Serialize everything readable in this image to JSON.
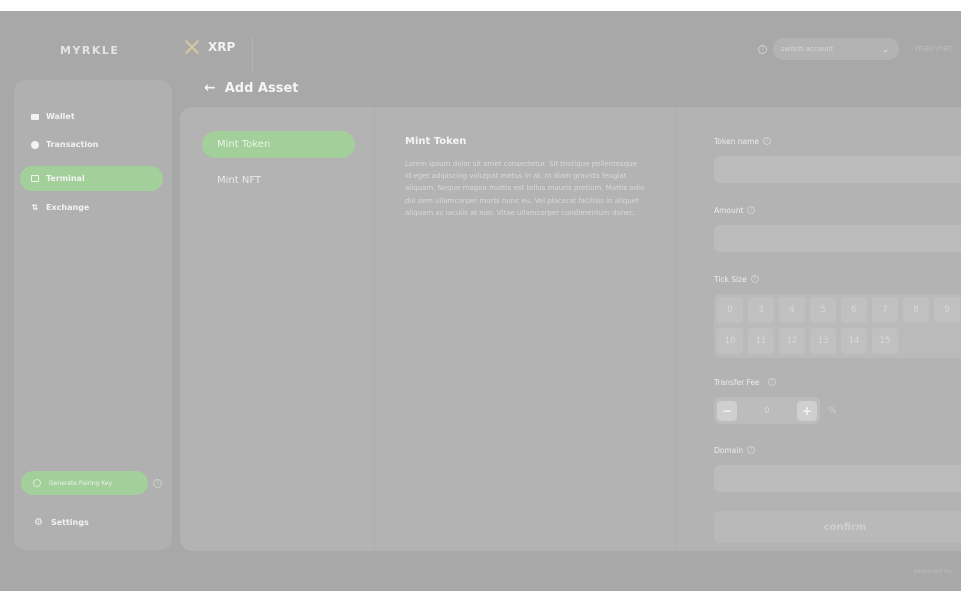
{
  "header": {
    "logo": "MYRKLE",
    "chain_label": "XRP",
    "switch_account_placeholder": "switch account",
    "network": "mainnet"
  },
  "sidebar": {
    "items": [
      {
        "label": "Wallet",
        "icon": "wallet-icon"
      },
      {
        "label": "Transaction",
        "icon": "transaction-icon"
      },
      {
        "label": "Terminal",
        "icon": "terminal-icon",
        "active": true
      },
      {
        "label": "Exchange",
        "icon": "exchange-icon"
      }
    ],
    "generate_key_label": "Generate Pairing Key",
    "settings_label": "Settings"
  },
  "page": {
    "title": "Add Asset"
  },
  "tabs": [
    {
      "label": "Mint Token",
      "active": true
    },
    {
      "label": "Mint NFT",
      "active": false
    }
  ],
  "description": {
    "title": "Mint Token",
    "body": "Lorem ipsum dolor sit amet consectetur. Sit tristique pellentesque id eget adipiscing volutpat metus in at. In diam gravida feugiat aliquam. Neque magna mattis est tellus mauris pretium. Mattis odio dui sem ullamcorper morbi nunc eu. Vel placerat facilisis in aliquet aliquam ac iaculis at non. Vitae ullamcorper condimentum donec."
  },
  "form": {
    "token_name_label": "Token name",
    "amount_label": "Amount",
    "tick_size_label": "Tick Size",
    "tick_sizes": [
      "0",
      "3",
      "4",
      "5",
      "6",
      "7",
      "8",
      "9",
      "10",
      "11",
      "12",
      "13",
      "14",
      "15"
    ],
    "transfer_fee_label": "Transfer Fee",
    "transfer_fee_value": "0",
    "transfer_fee_unit": "%",
    "decrement_label": "−",
    "increment_label": "+",
    "domain_label": "Domain",
    "confirm_label": "confirm"
  },
  "footer": {
    "powered": "powered by"
  },
  "colors": {
    "overlay": "#a8a8a8",
    "accent": "#a3cf9b"
  }
}
